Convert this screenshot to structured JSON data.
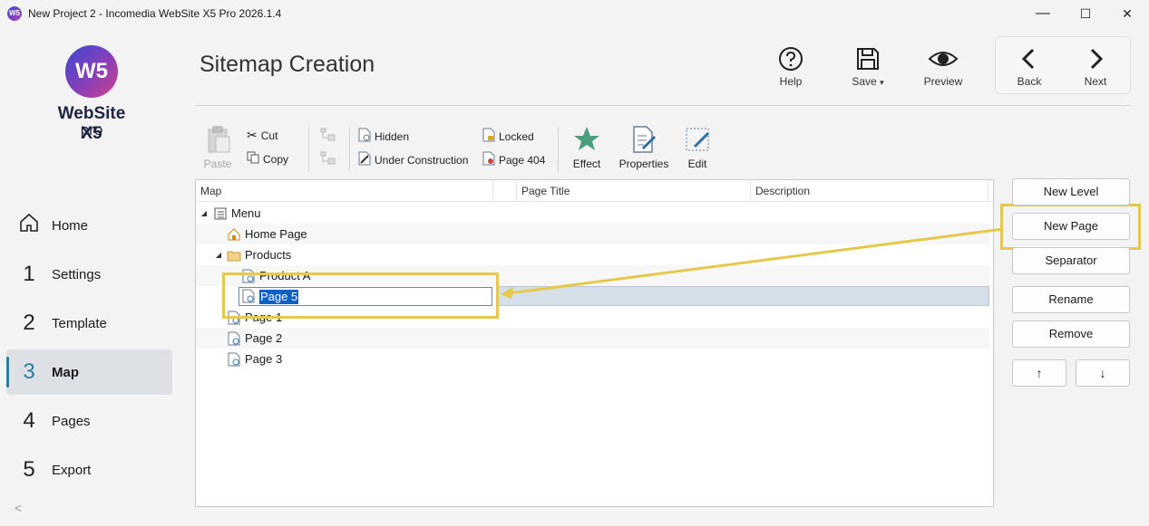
{
  "window": {
    "title": "New Project 2 - Incomedia WebSite X5 Pro 2026.1.4",
    "minimize": "—",
    "maximize": "☐",
    "close": "✕"
  },
  "logo": {
    "mark": "W5",
    "name": "WebSite X5",
    "edition": "pro"
  },
  "nav": [
    {
      "num": "",
      "label": "Home",
      "icon": "home-icon"
    },
    {
      "num": "1",
      "label": "Settings"
    },
    {
      "num": "2",
      "label": "Template"
    },
    {
      "num": "3",
      "label": "Map"
    },
    {
      "num": "4",
      "label": "Pages"
    },
    {
      "num": "5",
      "label": "Export"
    }
  ],
  "collapse_glyph": "<",
  "header": {
    "title": "Sitemap Creation",
    "help": "Help",
    "save": "Save",
    "save_caret": "▾",
    "preview": "Preview",
    "back": "Back",
    "next": "Next"
  },
  "toolbar": {
    "paste": "Paste",
    "cut": "Cut",
    "copy": "Copy",
    "hidden": "Hidden",
    "under_construction": "Under Construction",
    "locked": "Locked",
    "page404": "Page 404",
    "effect": "Effect",
    "properties": "Properties",
    "edit": "Edit"
  },
  "tree": {
    "columns": [
      "Map",
      "Page Title",
      "Description"
    ],
    "rows": [
      {
        "label": "Menu",
        "expand": "◢",
        "icon": "menu-icon"
      },
      {
        "label": "Home Page",
        "icon": "home-page-icon"
      },
      {
        "label": "Products",
        "expand": "◢",
        "icon": "folder-icon"
      },
      {
        "label": "Product A",
        "icon": "page-icon"
      },
      {
        "label": "Page 5",
        "icon": "page-icon"
      },
      {
        "label": "Page 1",
        "icon": "page-icon"
      },
      {
        "label": "Page 2",
        "icon": "page-icon"
      },
      {
        "label": "Page 3",
        "icon": "page-icon"
      }
    ]
  },
  "side_buttons": {
    "new_level": "New Level",
    "new_page": "New Page",
    "separator": "Separator",
    "rename": "Rename",
    "remove": "Remove",
    "move_up": "↑",
    "move_down": "↓"
  },
  "colors": {
    "accent": "#2b7fa0",
    "highlight": "#e6c84a",
    "selection": "#0a62c8"
  }
}
